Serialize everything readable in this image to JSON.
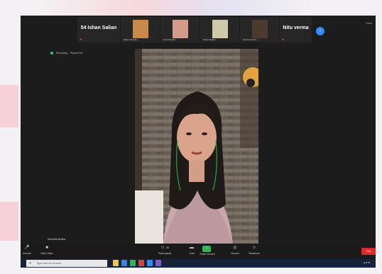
{
  "participants": [
    {
      "name": "54 Ishan Salian",
      "caption": "",
      "has_video": false
    },
    {
      "name": "",
      "caption": "Sakhi Chaudh...",
      "has_video": true,
      "color": "#c78a4b"
    },
    {
      "name": "",
      "caption": "Kunal Nayak",
      "has_video": true,
      "color": "#d49a8a"
    },
    {
      "name": "",
      "caption": "Shruti Dudhe",
      "has_video": true,
      "color": "#cfcaa8"
    },
    {
      "name": "",
      "caption": "Sai Snehal Kh...",
      "has_video": true,
      "color": "#4a3a2f"
    },
    {
      "name": "Nitu verma",
      "caption": "",
      "has_video": false
    }
  ],
  "recording": {
    "label": "Recording",
    "host": "Recent File"
  },
  "self_view_label": "Shreshta Bhatla",
  "corner_label": "View",
  "toolbar": {
    "mute": "Unmute",
    "video": "Start Video",
    "participants": "Participants",
    "participants_count": "26",
    "chat": "Chat",
    "share": "Share Screen",
    "record": "Record",
    "reactions": "Reactions",
    "end": "End"
  },
  "taskbar": {
    "search_placeholder": "Type here to search"
  }
}
